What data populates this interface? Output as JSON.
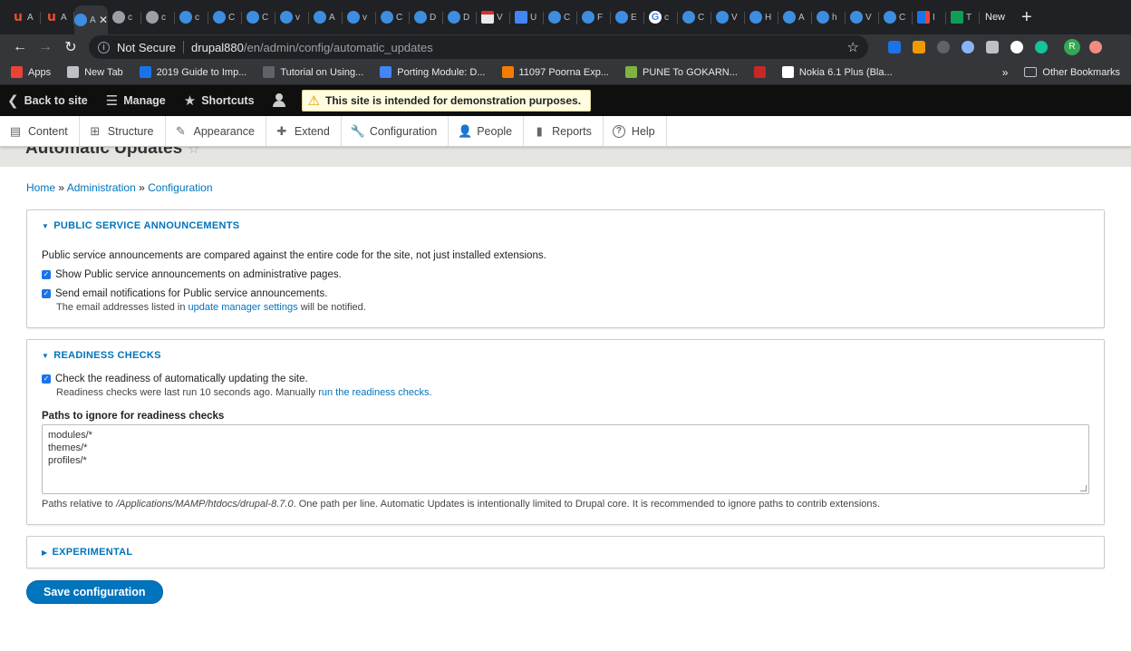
{
  "browser": {
    "tabs": [
      {
        "icon": "u-icon",
        "text": "A"
      },
      {
        "icon": "u-icon",
        "text": "A"
      },
      {
        "icon": "drupal-icon",
        "text": "A",
        "active": true
      },
      {
        "icon": "globe-icon",
        "text": "c"
      },
      {
        "icon": "globe-icon",
        "text": "c"
      },
      {
        "icon": "drupal-icon",
        "text": "c"
      },
      {
        "icon": "drupal-icon",
        "text": "C"
      },
      {
        "icon": "drupal-icon",
        "text": "C"
      },
      {
        "icon": "drupal-icon",
        "text": "v"
      },
      {
        "icon": "drupal-icon",
        "text": "A"
      },
      {
        "icon": "drupal-icon",
        "text": "v"
      },
      {
        "icon": "drupal-icon",
        "text": "C"
      },
      {
        "icon": "drupal-icon",
        "text": "D"
      },
      {
        "icon": "drupal-icon",
        "text": "D"
      },
      {
        "icon": "gmail-icon",
        "text": "V"
      },
      {
        "icon": "docs-icon",
        "text": "U"
      },
      {
        "icon": "drupal-icon",
        "text": "C"
      },
      {
        "icon": "drupal-icon",
        "text": "F"
      },
      {
        "icon": "drupal-icon",
        "text": "E"
      },
      {
        "icon": "google-icon",
        "text": "c"
      },
      {
        "icon": "drupal-icon",
        "text": "C"
      },
      {
        "icon": "drupal-icon",
        "text": "V"
      },
      {
        "icon": "drupal-icon",
        "text": "H"
      },
      {
        "icon": "drupal-icon",
        "text": "A"
      },
      {
        "icon": "drupal-icon",
        "text": "h"
      },
      {
        "icon": "drupal-icon",
        "text": "V"
      },
      {
        "icon": "drupal-icon",
        "text": "C"
      },
      {
        "icon": "trello-icon",
        "text": "I"
      },
      {
        "icon": "sheets-icon",
        "text": "T"
      }
    ],
    "active_close": "✕",
    "new_tab_label": "New",
    "new_tab_plus": "+",
    "security_label": "Not Secure",
    "url_host": "drupal880",
    "url_path": "/en/admin/config/automatic_updates",
    "avatar_letter": "R",
    "bookmarks": [
      {
        "label": "Apps",
        "color": "#ea4335"
      },
      {
        "label": "New Tab",
        "color": "#bdc1c6"
      },
      {
        "label": "2019 Guide to Imp...",
        "color": "#1a73e8"
      },
      {
        "label": "Tutorial on Using...",
        "color": "#5f6368"
      },
      {
        "label": "Porting Module: D...",
        "color": "#4285f4"
      },
      {
        "label": "11097 Poorna Exp...",
        "color": "#f57c00"
      },
      {
        "label": "PUNE To GOKARN...",
        "color": "#7cb342"
      },
      {
        "label": "",
        "color": "#c62828"
      },
      {
        "label": "Nokia 6.1 Plus (Bla...",
        "color": "#fff"
      }
    ],
    "bookmarks_more": "»",
    "other_bookmarks": "Other Bookmarks"
  },
  "drupal_toolbar": {
    "back_to_site": "Back to site",
    "manage": "Manage",
    "shortcuts": "Shortcuts",
    "demo_notice": "This site is intended for demonstration purposes."
  },
  "admin_tray": [
    {
      "label": "Content",
      "icon": "content-icon"
    },
    {
      "label": "Structure",
      "icon": "structure-icon"
    },
    {
      "label": "Appearance",
      "icon": "appearance-icon"
    },
    {
      "label": "Extend",
      "icon": "extend-icon"
    },
    {
      "label": "Configuration",
      "icon": "wrench-icon"
    },
    {
      "label": "People",
      "icon": "people-icon"
    },
    {
      "label": "Reports",
      "icon": "reports-icon"
    },
    {
      "label": "Help",
      "icon": "help-icon"
    }
  ],
  "page": {
    "title": "Automatic Updates",
    "breadcrumb": [
      "Home",
      "Administration",
      "Configuration"
    ],
    "breadcrumb_sep": "»",
    "psa": {
      "legend": "PUBLIC SERVICE ANNOUNCEMENTS",
      "description": "Public service announcements are compared against the entire code for the site, not just installed extensions.",
      "show_psa_label": "Show Public service announcements on administrative pages.",
      "email_label": "Send email notifications for Public service announcements.",
      "email_desc_prefix": "The email addresses listed in",
      "email_desc_link": "update manager settings",
      "email_desc_suffix": "will be notified."
    },
    "readiness": {
      "legend": "READINESS CHECKS",
      "check_label": "Check the readiness of automatically updating the site.",
      "check_desc_prefix": "Readiness checks were last run 10 seconds ago. Manually",
      "check_desc_link": "run the readiness checks",
      "check_desc_suffix": ".",
      "paths_label": "Paths to ignore for readiness checks",
      "paths_lines": [
        "modules/*",
        "themes/*",
        "profiles/*"
      ],
      "help_prefix": "Paths relative to",
      "help_path": "/Applications/MAMP/htdocs/drupal-8.7.0",
      "help_suffix": ". One path per line. Automatic Updates is intentionally limited to Drupal core. It is recommended to ignore paths to contrib extensions."
    },
    "experimental": {
      "legend": "EXPERIMENTAL"
    },
    "save_label": "Save configuration"
  }
}
